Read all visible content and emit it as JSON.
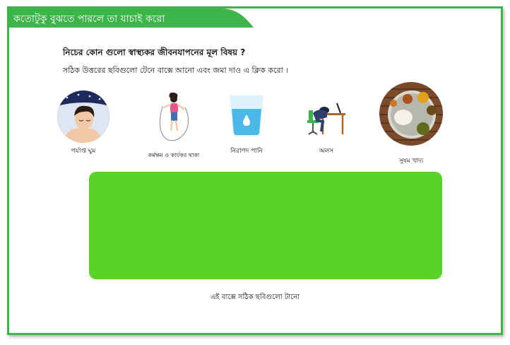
{
  "header": {
    "title": "কতোটুকু বুঝতে পারলে তা যাচাই করো",
    "color": "#3cb64a"
  },
  "question": "নিচের কোন গুলো স্বাস্থ্যকর জীবনযাপনের মূল বিষয় ?",
  "instruction": "সঠিক উত্তরের ছবিগুলো টেনে বাক্সে আনো এবং জমা দাও এ ক্লিক করো ।",
  "cards": [
    {
      "label": "পর্যাপ্ত ঘুম",
      "icon": "sleeping-person-icon"
    },
    {
      "label": "কর্মক্ষম ও কার্যকর থাকা",
      "icon": "jump-rope-icon"
    },
    {
      "label": "নিরাপদ পানি",
      "icon": "water-glass-icon"
    },
    {
      "label": "অলস",
      "icon": "lazy-person-at-desk-icon"
    },
    {
      "label": "সুষম খাদ্য",
      "icon": "balanced-meal-plate-icon"
    }
  ],
  "dropzone": {
    "hint": "এই বাক্সে সঠিক ছবিগুলো টানো",
    "color": "#58d32a"
  }
}
